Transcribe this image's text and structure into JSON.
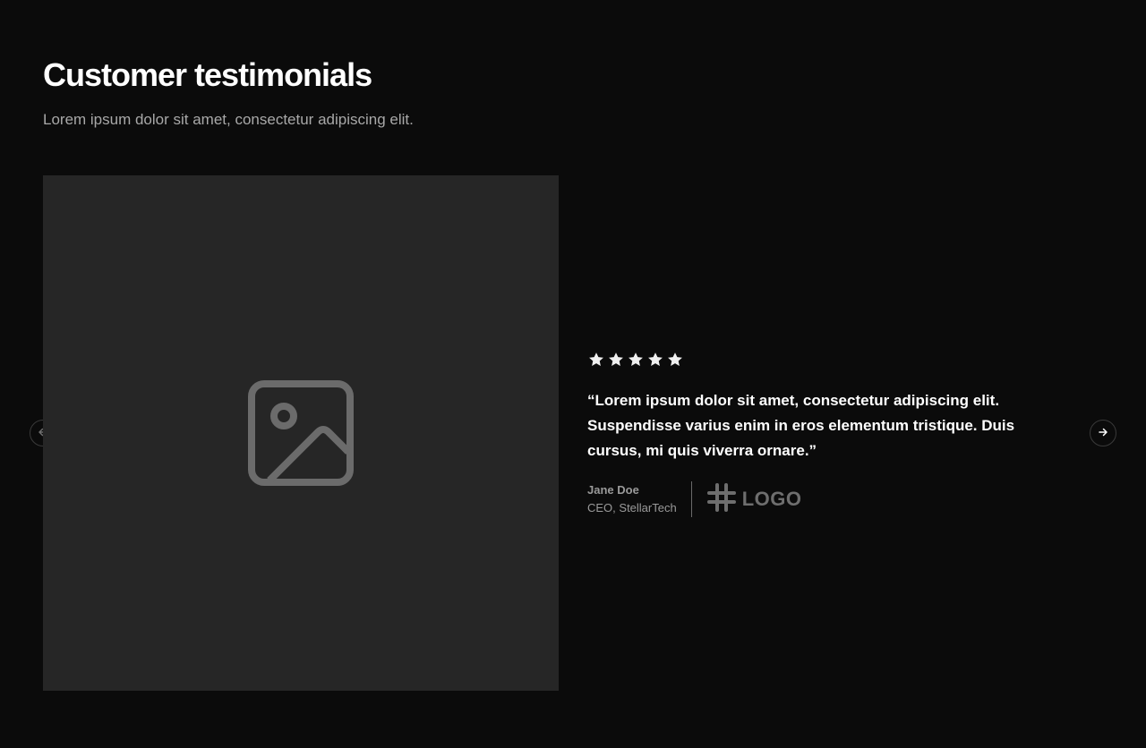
{
  "header": {
    "title": "Customer testimonials",
    "subtitle": "Lorem ipsum dolor sit amet, consectetur adipiscing elit."
  },
  "media": {
    "icon": "image-placeholder-icon"
  },
  "testimonial": {
    "rating": 5,
    "rating_max": 5,
    "quote": "“Lorem ipsum dolor sit amet, consectetur adipiscing elit. Suspendisse varius enim in eros elementum tristique. Duis cursus, mi quis viverra ornare.”",
    "author_name": "Jane Doe",
    "author_title": "CEO, StellarTech",
    "logo_text": "LOGO",
    "logo_icon": "hash-icon"
  },
  "navigation": {
    "prev_icon": "arrow-left-icon",
    "next_icon": "arrow-right-icon"
  },
  "colors": {
    "background": "#0b0b0b",
    "placeholder": "#262626",
    "text_primary": "#ffffff",
    "text_muted": "#a8a8a8"
  }
}
